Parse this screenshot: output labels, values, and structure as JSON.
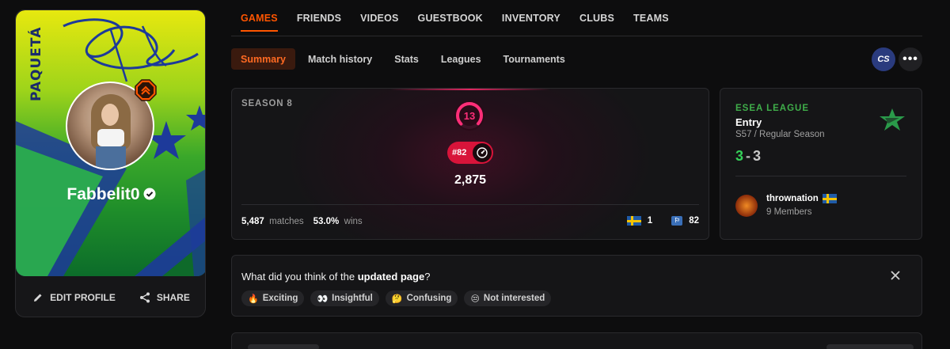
{
  "profile": {
    "banner_text": "PAQUETÁ",
    "username": "Fabbelit0",
    "actions": {
      "edit": "EDIT PROFILE",
      "share": "SHARE"
    }
  },
  "top_nav": {
    "tabs": [
      "GAMES",
      "FRIENDS",
      "VIDEOS",
      "GUESTBOOK",
      "INVENTORY",
      "CLUBS",
      "TEAMS"
    ],
    "active": "GAMES"
  },
  "sub_nav": {
    "tabs": [
      "Summary",
      "Match history",
      "Stats",
      "Leagues",
      "Tournaments"
    ],
    "active": "Summary",
    "game_chip": "CS",
    "more": "•••"
  },
  "season": {
    "label": "SEASON 8",
    "level": "13",
    "rank": "#82",
    "elo": "2,875",
    "matches": "5,487",
    "matches_label": "matches",
    "winrate": "53.0%",
    "wins_label": "wins",
    "country_rank": "1",
    "region_rank": "82"
  },
  "league": {
    "title": "ESEA LEAGUE",
    "division": "Entry",
    "season": "S57 / Regular Season",
    "wins": "3",
    "separator": "-",
    "losses": "3",
    "team_name": "thrownation",
    "team_members": "9 Members"
  },
  "feedback": {
    "question_prefix": "What did you think of the ",
    "question_bold": "updated page",
    "question_suffix": "?",
    "reactions": [
      {
        "emoji": "🔥",
        "label": "Exciting"
      },
      {
        "emoji": "👀",
        "label": "Insightful"
      },
      {
        "emoji": "🤔",
        "label": "Confusing"
      },
      {
        "emoji": "😒",
        "label": "Not interested"
      }
    ]
  },
  "colors": {
    "accent": "#ff5500",
    "level_pink": "#ff2e78",
    "rank_red": "#d8143a",
    "league_green": "#3fae4a",
    "win_green": "#34d058"
  }
}
